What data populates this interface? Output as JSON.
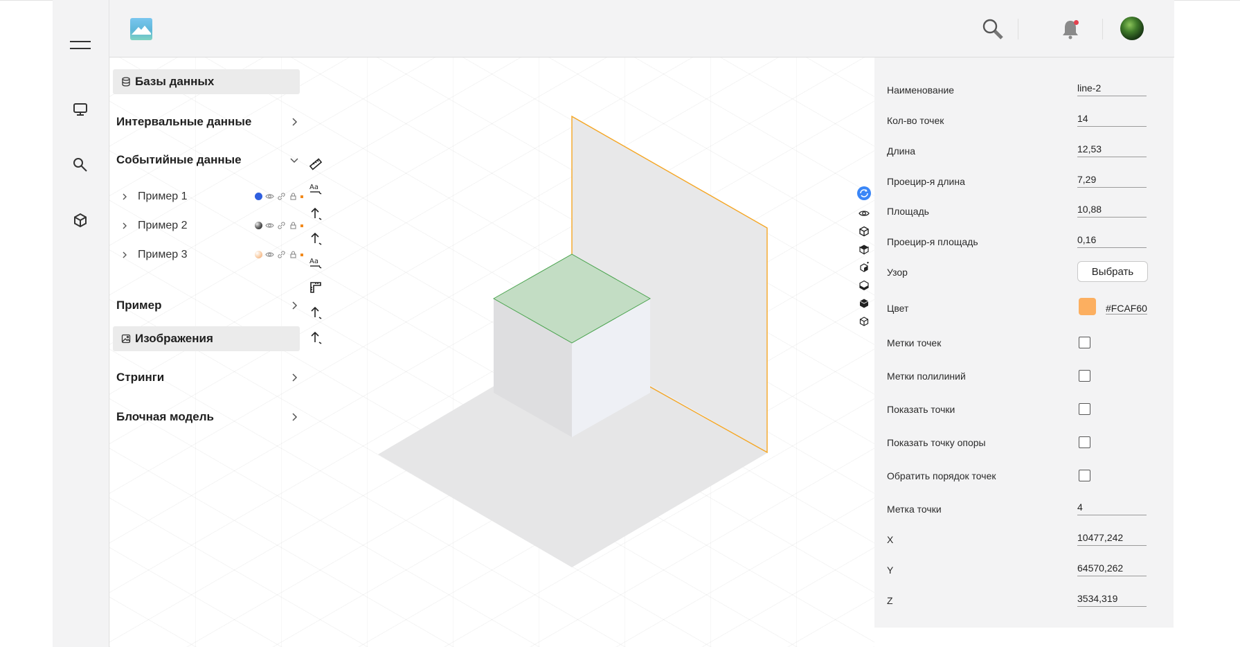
{
  "sidebar": {
    "sections": [
      {
        "label": "Базы данных",
        "type": "pill",
        "icon": "database-icon"
      },
      {
        "label": "Интервальные данные",
        "type": "collapsed"
      },
      {
        "label": "Событийные данные",
        "type": "expanded"
      },
      {
        "label": "Пример",
        "type": "collapsed"
      },
      {
        "label": "Изображения",
        "type": "pill",
        "icon": "image-icon"
      },
      {
        "label": "Стринги",
        "type": "collapsed"
      },
      {
        "label": "Блочная модель",
        "type": "collapsed"
      }
    ],
    "items": [
      {
        "label": "Пример 1",
        "color": "#2f5fdf",
        "style": "solid"
      },
      {
        "label": "Пример 2",
        "color": "#555555",
        "style": "dark-gradient"
      },
      {
        "label": "Пример 3",
        "color": "#f7c9a0",
        "style": "light-gradient"
      }
    ]
  },
  "toolbar_left": [
    "ruler-icon",
    "text-label-icon",
    "arrow-up-icon",
    "arrow-up-icon",
    "text-label-icon",
    "corner-ruler-icon",
    "arrow-up-icon",
    "arrow-up-icon"
  ],
  "toolbar_right": [
    "rotate-view-icon",
    "eye-icon",
    "cube-outline-icon",
    "cube-solid-icon",
    "cube-plus-icon",
    "cube-layers-icon",
    "cube-dark-icon",
    "cube-small-icon"
  ],
  "properties": {
    "name_label": "Наименование",
    "name_value": "line-2",
    "points_label": "Кол-во точек",
    "points_value": "14",
    "length_label": "Длина",
    "length_value": "12,53",
    "proj_length_label": "Проецир-я длина",
    "proj_length_value": "7,29",
    "area_label": "Площадь",
    "area_value": "10,88",
    "proj_area_label": "Проецир-я площадь",
    "proj_area_value": "0,16",
    "pattern_label": "Узор",
    "pattern_button": "Выбрать",
    "color_label": "Цвет",
    "color_value": "#FCAF60",
    "point_marks_label": "Метки точек",
    "polyline_marks_label": "Метки полилиний",
    "show_points_label": "Показать точки",
    "show_anchor_label": "Показать точку опоры",
    "reverse_order_label": "Обратить порядок точек",
    "point_mark_label": "Метка точки",
    "point_mark_value": "4",
    "x_label": "X",
    "x_value": "10477,242",
    "y_label": "Y",
    "y_value": "64570,262",
    "z_label": "Z",
    "z_value": "3534,319"
  },
  "colors": {
    "accent": "#3a86f7",
    "line": "#f5a623",
    "green_face": "#c3ddc4",
    "panel_bg": "#f3f3f4"
  }
}
